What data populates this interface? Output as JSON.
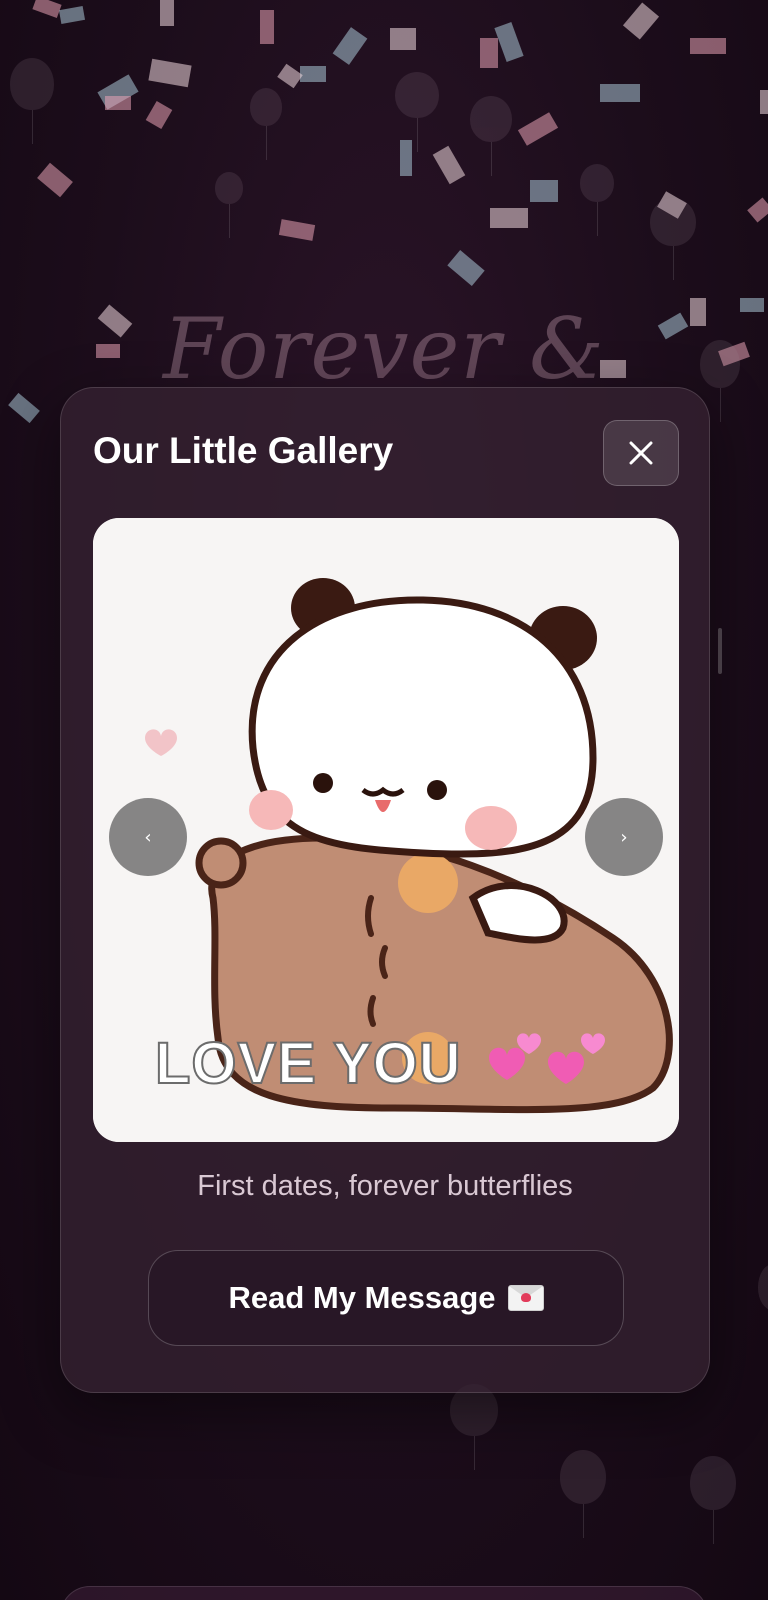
{
  "background": {
    "heading": "Forever &",
    "colors": {
      "base": "#1a0c19",
      "confetti": [
        "#e8a3b4",
        "#a9c7d6",
        "#f0d9df"
      ]
    }
  },
  "modal": {
    "title": "Our Little Gallery",
    "close_icon": "close-icon",
    "gallery": {
      "image_overlay_text": "LOVE YOU",
      "prev_label": "‹",
      "next_label": "›",
      "caption": "First dates, forever butterflies"
    },
    "read_button": {
      "label": "Read My Message",
      "icon": "envelope-icon"
    }
  }
}
